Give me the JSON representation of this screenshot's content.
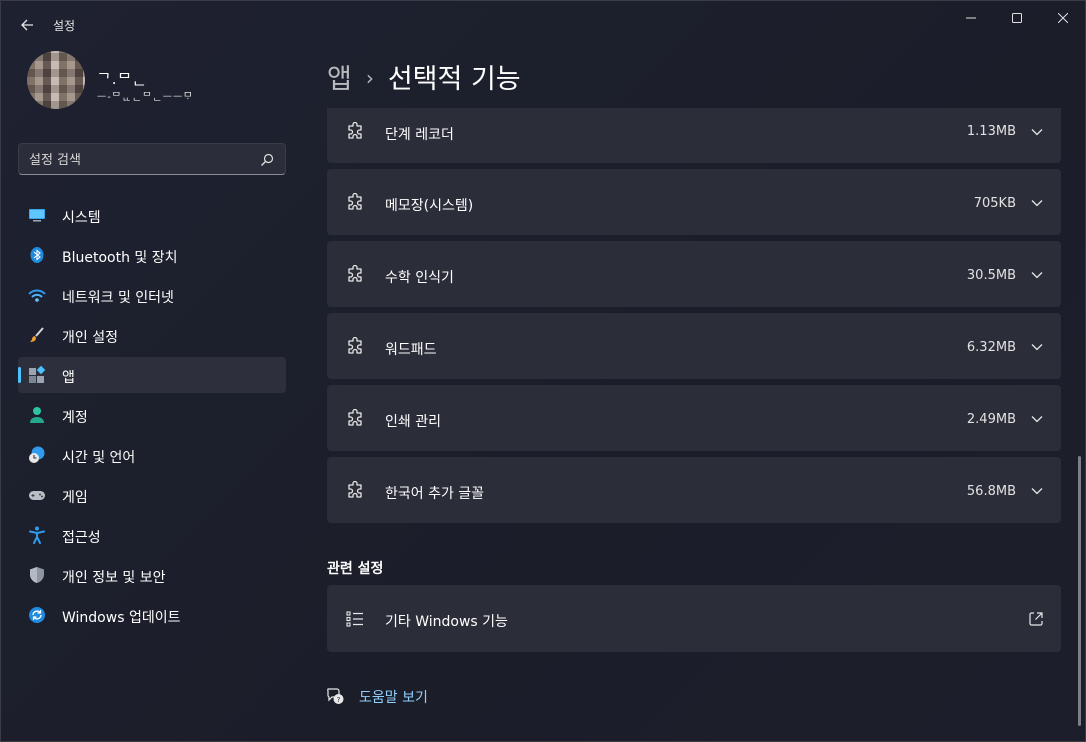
{
  "window": {
    "title": "설정",
    "controls": [
      "minimize-icon",
      "maximize-icon",
      "close-icon"
    ]
  },
  "profile": {
    "name": "ᄀ.ᄆᆫ",
    "email": "ᅳ-ᄆᆫᆫᆫᄆᆫᅳᅳᄆᆞ"
  },
  "search": {
    "placeholder": "설정 검색",
    "value": ""
  },
  "sidebar": {
    "items": [
      {
        "label": "시스템",
        "icon": "system-icon",
        "active": false
      },
      {
        "label": "Bluetooth 및 장치",
        "icon": "bluetooth-icon",
        "active": false
      },
      {
        "label": "네트워크 및 인터넷",
        "icon": "wifi-icon",
        "active": false
      },
      {
        "label": "개인 설정",
        "icon": "brush-icon",
        "active": false
      },
      {
        "label": "앱",
        "icon": "apps-icon",
        "active": true
      },
      {
        "label": "계정",
        "icon": "person-icon",
        "active": false
      },
      {
        "label": "시간 및 언어",
        "icon": "clock-globe-icon",
        "active": false
      },
      {
        "label": "게임",
        "icon": "gamepad-icon",
        "active": false
      },
      {
        "label": "접근성",
        "icon": "accessibility-icon",
        "active": false
      },
      {
        "label": "개인 정보 및 보안",
        "icon": "shield-icon",
        "active": false
      },
      {
        "label": "Windows 업데이트",
        "icon": "update-icon",
        "active": false
      }
    ]
  },
  "breadcrumb": {
    "parent": "앱",
    "separator": "›",
    "current": "선택적 기능"
  },
  "features": [
    {
      "name": "단계 레코더",
      "size": "1.13MB"
    },
    {
      "name": "메모장(시스템)",
      "size": "705KB"
    },
    {
      "name": "수학 인식기",
      "size": "30.5MB"
    },
    {
      "name": "워드패드",
      "size": "6.32MB"
    },
    {
      "name": "인쇄 관리",
      "size": "2.49MB"
    },
    {
      "name": "한국어 추가 글꼴",
      "size": "56.8MB"
    }
  ],
  "related": {
    "title": "관련 설정",
    "item_label": "기타 Windows 기능"
  },
  "help": {
    "label": "도움말 보기"
  },
  "colors": {
    "accent": "#4cc2ff",
    "background": "#1c1f2a",
    "card": "#2b2e39",
    "link": "#8fd0ff"
  }
}
